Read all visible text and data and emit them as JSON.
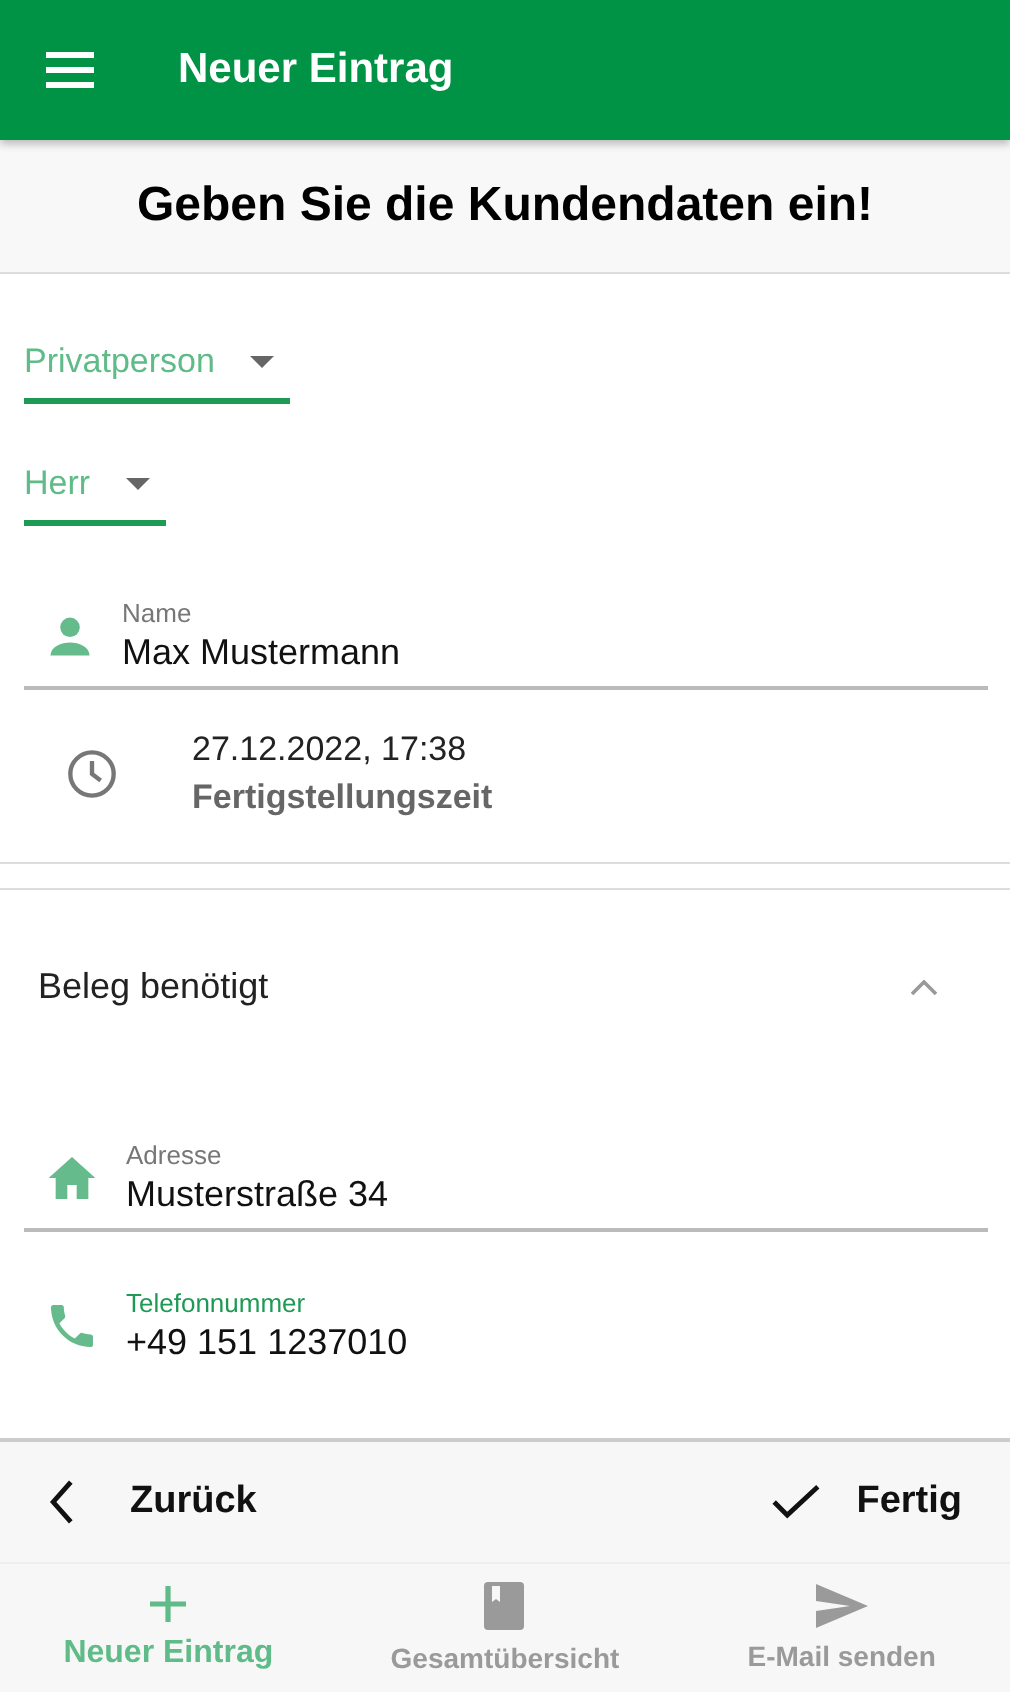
{
  "app_bar": {
    "title": "Neuer Eintrag"
  },
  "heading": "Geben Sie die Kundendaten ein!",
  "selects": [
    {
      "value": "Privatperson"
    },
    {
      "value": "Herr"
    }
  ],
  "name_field": {
    "label": "Name",
    "value": "Max Mustermann",
    "focused": false
  },
  "completion": {
    "value": "27.12.2022, 17:38",
    "label": "Fertigstellungszeit"
  },
  "receipt_panel": {
    "title": "Beleg benötigt",
    "expanded": true,
    "fields": [
      {
        "kind": "address",
        "label": "Adresse",
        "value": "Musterstraße 34",
        "focused": false
      },
      {
        "kind": "phone",
        "label": "Telefonnummer",
        "value": "+49 151 1237010",
        "focused": true
      }
    ]
  },
  "actions": {
    "back": "Zurück",
    "done": "Fertig"
  },
  "bottom_nav": [
    {
      "kind": "add",
      "label": "Neuer Eintrag",
      "selected": true
    },
    {
      "kind": "overview",
      "label": "Gesamtübersicht",
      "selected": false
    },
    {
      "kind": "email",
      "label": "E-Mail senden",
      "selected": false
    }
  ]
}
